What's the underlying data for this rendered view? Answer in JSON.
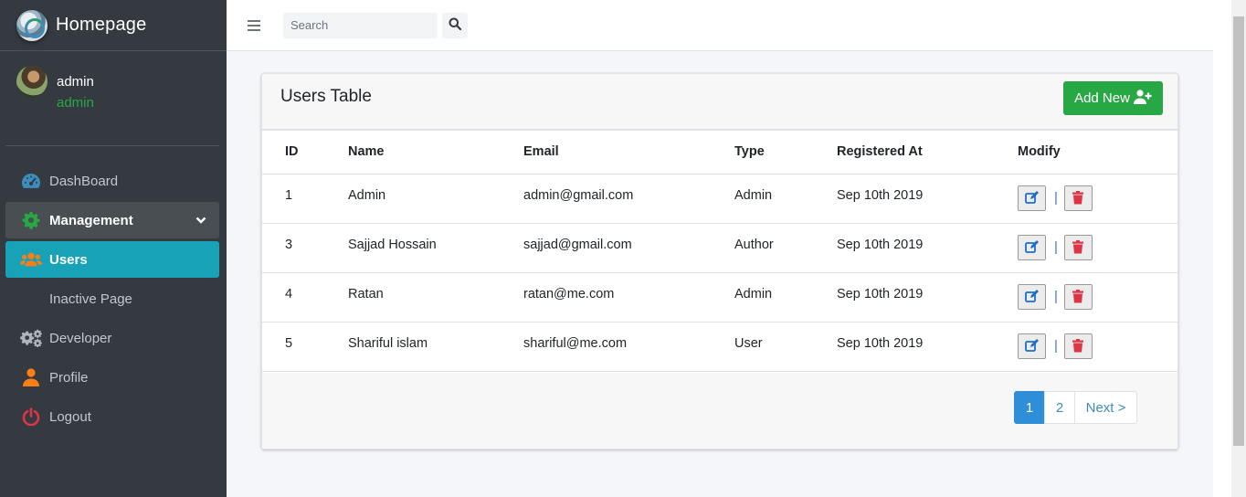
{
  "app": {
    "title": "Homepage"
  },
  "user": {
    "name": "admin",
    "role": "admin"
  },
  "sidebar": {
    "items": [
      {
        "label": "DashBoard",
        "icon": "tachometer-icon"
      },
      {
        "label": "Management",
        "icon": "gear-icon"
      },
      {
        "label": "Users",
        "icon": "users-icon"
      },
      {
        "label": "Inactive Page"
      },
      {
        "label": "Developer",
        "icon": "gears-icon"
      },
      {
        "label": "Profile",
        "icon": "user-icon"
      },
      {
        "label": "Logout",
        "icon": "power-icon"
      }
    ]
  },
  "topbar": {
    "search_placeholder": "Search"
  },
  "card": {
    "title": "Users Table",
    "add_label": "Add New",
    "columns": [
      "ID",
      "Name",
      "Email",
      "Type",
      "Registered At",
      "Modify"
    ],
    "rows": [
      {
        "id": "1",
        "name": "Admin",
        "email": "admin@gmail.com",
        "type": "Admin",
        "registered": "Sep 10th 2019"
      },
      {
        "id": "3",
        "name": "Sajjad Hossain",
        "email": "sajjad@gmail.com",
        "type": "Author",
        "registered": "Sep 10th 2019"
      },
      {
        "id": "4",
        "name": "Ratan",
        "email": "ratan@me.com",
        "type": "Admin",
        "registered": "Sep 10th 2019"
      },
      {
        "id": "5",
        "name": "Shariful islam",
        "email": "shariful@me.com",
        "type": "User",
        "registered": "Sep 10th 2019"
      }
    ],
    "separator": "|"
  },
  "pagination": {
    "pages": [
      "1",
      "2"
    ],
    "current": "1",
    "next_label": "Next >"
  },
  "colors": {
    "sidebar": "#343a40",
    "active": "#17a2b8",
    "success": "#28a745",
    "primary": "#2e8fd8",
    "danger": "#dc3545"
  }
}
